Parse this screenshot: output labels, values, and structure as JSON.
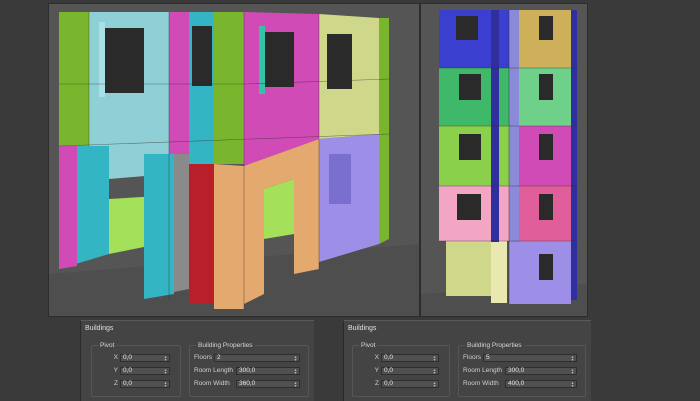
{
  "left_panel": {
    "title": "Buildings",
    "pivot": {
      "title": "Pivot",
      "x_label": "X",
      "x_value": "0,0",
      "y_label": "Y",
      "y_value": "0,0",
      "z_label": "Z",
      "z_value": "0,0"
    },
    "properties": {
      "title": "Building Properties",
      "floors_label": "Floors",
      "floors_value": "2",
      "room_length_label": "Room Length",
      "room_length_value": "300,0",
      "room_width_label": "Room Width",
      "room_width_value": "360,0"
    }
  },
  "right_panel": {
    "title": "Buildings",
    "pivot": {
      "title": "Pivot",
      "x_label": "X",
      "x_value": "0,0",
      "y_label": "Y",
      "y_value": "0,0",
      "z_label": "Z",
      "z_value": "0,0"
    },
    "properties": {
      "title": "Building Properties",
      "floors_label": "Floors",
      "floors_value": "5",
      "room_length_label": "Room Length",
      "room_length_value": "300,0",
      "room_width_label": "Room Width",
      "room_width_value": "400,0"
    }
  },
  "colors": {
    "background": "#3a3a3a",
    "viewport": "#555555",
    "panel": "#444444",
    "green": "#7ab52e",
    "cyan": "#33b5c4",
    "magenta": "#d04bb6",
    "pink": "#e05fc6",
    "peach": "#e3a96e",
    "lavender": "#9d8fe8",
    "blue": "#3a3fd0",
    "red": "#b81f2a",
    "yellow_green": "#cfd88a"
  }
}
